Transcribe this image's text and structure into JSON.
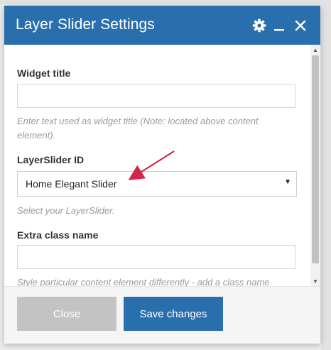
{
  "window": {
    "title": "Layer Slider Settings",
    "icons": [
      "gear-icon",
      "minimize-icon",
      "close-icon"
    ],
    "accent_color": "#2a6fad"
  },
  "fields": {
    "widget_title": {
      "label": "Widget title",
      "value": "",
      "help": "Enter text used as widget title (Note: located above content element)."
    },
    "layerslider_id": {
      "label": "LayerSlider ID",
      "selected": "Home Elegant Slider",
      "help": "Select your LayerSlider."
    },
    "extra_class": {
      "label": "Extra class name",
      "value": "",
      "help": "Style particular content element differently - add a class name"
    }
  },
  "footer": {
    "close_label": "Close",
    "save_label": "Save changes"
  },
  "annotation": {
    "arrow_color": "#d6234a"
  }
}
